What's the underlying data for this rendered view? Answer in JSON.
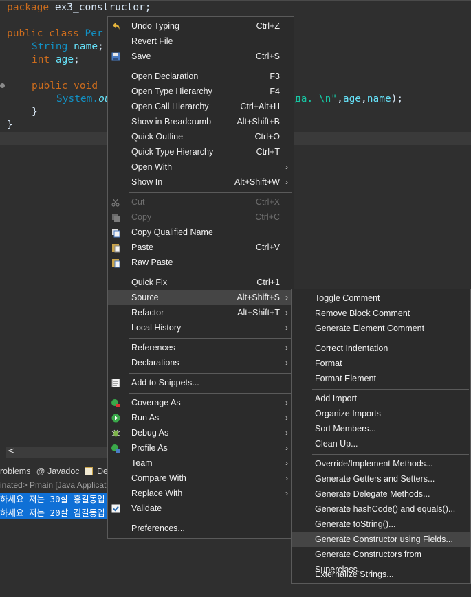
{
  "editor": {
    "line1": {
      "kw": "package",
      "rest": " ex3_constructor;"
    },
    "line2": {
      "kw1": "public",
      "kw2": "class",
      "cls": "Per"
    },
    "line3": {
      "type": "String",
      "field": "name",
      "end": ";"
    },
    "line4": {
      "type": "int",
      "field": "age",
      "end": ";"
    },
    "line5": {
      "kw1": "public",
      "kw2": "void"
    },
    "line6": {
      "type": "System.",
      "partial": "ou",
      "str": "да. \\n\"",
      "p1": ",",
      "f1": "age",
      "p2": ",",
      "f2": "name",
      "end": ");"
    },
    "line7": "}",
    "line8": "}"
  },
  "scroll": {
    "left_arrow": "<"
  },
  "panel": {
    "tabs": [
      "roblems",
      "Javadoc",
      "De"
    ],
    "console_header": "inated> Pmain [Java Applicat",
    "console_lines": [
      "하세요 저는 30살 홍길동입",
      "하세요 저는 20살 김길동입"
    ]
  },
  "menu": {
    "items": [
      {
        "label": "Undo Typing",
        "accel": "Ctrl+Z",
        "icon": "undo-icon"
      },
      {
        "label": "Revert File",
        "accel": ""
      },
      {
        "label": "Save",
        "accel": "Ctrl+S",
        "icon": "save-icon"
      },
      {
        "label": "Open Declaration",
        "accel": "F3"
      },
      {
        "label": "Open Type Hierarchy",
        "accel": "F4"
      },
      {
        "label": "Open Call Hierarchy",
        "accel": "Ctrl+Alt+H"
      },
      {
        "label": "Show in Breadcrumb",
        "accel": "Alt+Shift+B"
      },
      {
        "label": "Quick Outline",
        "accel": "Ctrl+O"
      },
      {
        "label": "Quick Type Hierarchy",
        "accel": "Ctrl+T"
      },
      {
        "label": "Open With",
        "accel": "",
        "sub": true
      },
      {
        "label": "Show In",
        "accel": "Alt+Shift+W",
        "sub": true
      },
      {
        "label": "Cut",
        "accel": "Ctrl+X",
        "disabled": true,
        "icon": "cut-icon"
      },
      {
        "label": "Copy",
        "accel": "Ctrl+C",
        "disabled": true,
        "icon": "copy-icon"
      },
      {
        "label": "Copy Qualified Name",
        "accel": "",
        "icon": "copy-qualified-name-icon"
      },
      {
        "label": "Paste",
        "accel": "Ctrl+V",
        "icon": "paste-icon"
      },
      {
        "label": "Raw Paste",
        "accel": "",
        "icon": "raw-paste-icon"
      },
      {
        "label": "Quick Fix",
        "accel": "Ctrl+1"
      },
      {
        "label": "Source",
        "accel": "Alt+Shift+S",
        "sub": true,
        "highlight": true
      },
      {
        "label": "Refactor",
        "accel": "Alt+Shift+T",
        "sub": true
      },
      {
        "label": "Local History",
        "accel": "",
        "sub": true
      },
      {
        "label": "References",
        "accel": "",
        "sub": true
      },
      {
        "label": "Declarations",
        "accel": "",
        "sub": true
      },
      {
        "label": "Add to Snippets...",
        "accel": "",
        "icon": "snippets-icon"
      },
      {
        "label": "Coverage As",
        "accel": "",
        "sub": true,
        "icon": "coverage-icon"
      },
      {
        "label": "Run As",
        "accel": "",
        "sub": true,
        "icon": "run-icon"
      },
      {
        "label": "Debug As",
        "accel": "",
        "sub": true,
        "icon": "debug-icon"
      },
      {
        "label": "Profile As",
        "accel": "",
        "sub": true,
        "icon": "profile-icon"
      },
      {
        "label": "Team",
        "accel": "",
        "sub": true
      },
      {
        "label": "Compare With",
        "accel": "",
        "sub": true
      },
      {
        "label": "Replace With",
        "accel": "",
        "sub": true
      },
      {
        "label": "Validate",
        "accel": "",
        "icon": "checkbox-icon"
      },
      {
        "label": "Preferences...",
        "accel": ""
      }
    ]
  },
  "submenu": {
    "items": [
      {
        "label": "Toggle Comment"
      },
      {
        "label": "Remove Block Comment"
      },
      {
        "label": "Generate Element Comment"
      },
      {
        "label": "Correct Indentation"
      },
      {
        "label": "Format"
      },
      {
        "label": "Format Element"
      },
      {
        "label": "Add Import"
      },
      {
        "label": "Organize Imports"
      },
      {
        "label": "Sort Members..."
      },
      {
        "label": "Clean Up..."
      },
      {
        "label": "Override/Implement Methods..."
      },
      {
        "label": "Generate Getters and Setters..."
      },
      {
        "label": "Generate Delegate Methods..."
      },
      {
        "label": "Generate hashCode() and equals()..."
      },
      {
        "label": "Generate toString()..."
      },
      {
        "label": "Generate Constructor using Fields...",
        "highlight": true
      },
      {
        "label": "Generate Constructors from Superclass..."
      },
      {
        "label": "Externalize Strings..."
      }
    ]
  }
}
